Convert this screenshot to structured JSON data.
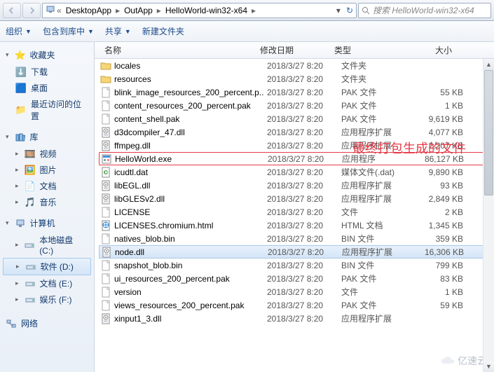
{
  "breadcrumbs": {
    "seg1": "DesktopApp",
    "seg2": "OutApp",
    "seg3": "HelloWorld-win32-x64"
  },
  "search_placeholder": "搜索 HelloWorld-win32-x64",
  "toolbar2": {
    "organize": "组织",
    "include_lib": "包含到库中",
    "share": "共享",
    "new_folder": "新建文件夹"
  },
  "sidebar": {
    "favorites": {
      "label": "收藏夹",
      "items": [
        "下载",
        "桌面",
        "最近访问的位置"
      ]
    },
    "libraries": {
      "label": "库",
      "items": [
        "视频",
        "图片",
        "文档",
        "音乐"
      ]
    },
    "computer": {
      "label": "计算机",
      "items": [
        "本地磁盘 (C:)",
        "软件 (D:)",
        "文档 (E:)",
        "娱乐 (F:)"
      ]
    },
    "network": {
      "label": "网络"
    }
  },
  "columns": {
    "name": "名称",
    "date": "修改日期",
    "type": "类型",
    "size": "大小"
  },
  "files": [
    {
      "icon": "folder",
      "name": "locales",
      "date": "2018/3/27 8:20",
      "type": "文件夹",
      "size": ""
    },
    {
      "icon": "folder",
      "name": "resources",
      "date": "2018/3/27 8:20",
      "type": "文件夹",
      "size": ""
    },
    {
      "icon": "file",
      "name": "blink_image_resources_200_percent.p..",
      "date": "2018/3/27 8:20",
      "type": "PAK 文件",
      "size": "55 KB"
    },
    {
      "icon": "file",
      "name": "content_resources_200_percent.pak",
      "date": "2018/3/27 8:20",
      "type": "PAK 文件",
      "size": "1 KB"
    },
    {
      "icon": "file",
      "name": "content_shell.pak",
      "date": "2018/3/27 8:20",
      "type": "PAK 文件",
      "size": "9,619 KB"
    },
    {
      "icon": "dll",
      "name": "d3dcompiler_47.dll",
      "date": "2018/3/27 8:20",
      "type": "应用程序扩展",
      "size": "4,077 KB"
    },
    {
      "icon": "dll",
      "name": "ffmpeg.dll",
      "date": "2018/3/27 8:20",
      "type": "应用程序扩展",
      "size": "2,207 KB"
    },
    {
      "icon": "exe",
      "name": "HelloWorld.exe",
      "date": "2018/3/27 8:20",
      "type": "应用程序",
      "size": "86,127 KB",
      "highlight": true
    },
    {
      "icon": "dat",
      "name": "icudtl.dat",
      "date": "2018/3/27 8:20",
      "type": "媒体文件(.dat)",
      "size": "9,890 KB"
    },
    {
      "icon": "dll",
      "name": "libEGL.dll",
      "date": "2018/3/27 8:20",
      "type": "应用程序扩展",
      "size": "93 KB"
    },
    {
      "icon": "dll",
      "name": "libGLESv2.dll",
      "date": "2018/3/27 8:20",
      "type": "应用程序扩展",
      "size": "2,849 KB"
    },
    {
      "icon": "file",
      "name": "LICENSE",
      "date": "2018/3/27 8:20",
      "type": "文件",
      "size": "2 KB"
    },
    {
      "icon": "html",
      "name": "LICENSES.chromium.html",
      "date": "2018/3/27 8:20",
      "type": "HTML 文档",
      "size": "1,345 KB"
    },
    {
      "icon": "file",
      "name": "natives_blob.bin",
      "date": "2018/3/27 8:20",
      "type": "BIN 文件",
      "size": "359 KB"
    },
    {
      "icon": "dll",
      "name": "node.dll",
      "date": "2018/3/27 8:20",
      "type": "应用程序扩展",
      "size": "16,306 KB",
      "selected": true
    },
    {
      "icon": "file",
      "name": "snapshot_blob.bin",
      "date": "2018/3/27 8:20",
      "type": "BIN 文件",
      "size": "799 KB"
    },
    {
      "icon": "file",
      "name": "ui_resources_200_percent.pak",
      "date": "2018/3/27 8:20",
      "type": "PAK 文件",
      "size": "83 KB"
    },
    {
      "icon": "file",
      "name": "version",
      "date": "2018/3/27 8:20",
      "type": "文件",
      "size": "1 KB"
    },
    {
      "icon": "file",
      "name": "views_resources_200_percent.pak",
      "date": "2018/3/27 8:20",
      "type": "PAK 文件",
      "size": "59 KB"
    },
    {
      "icon": "dll",
      "name": "xinput1_3.dll",
      "date": "2018/3/27 8:20",
      "type": "应用程序扩展",
      "size": ""
    }
  ],
  "annotation": "最终打包生成的文件",
  "watermark": "亿速云",
  "selected_drive_index": 1
}
